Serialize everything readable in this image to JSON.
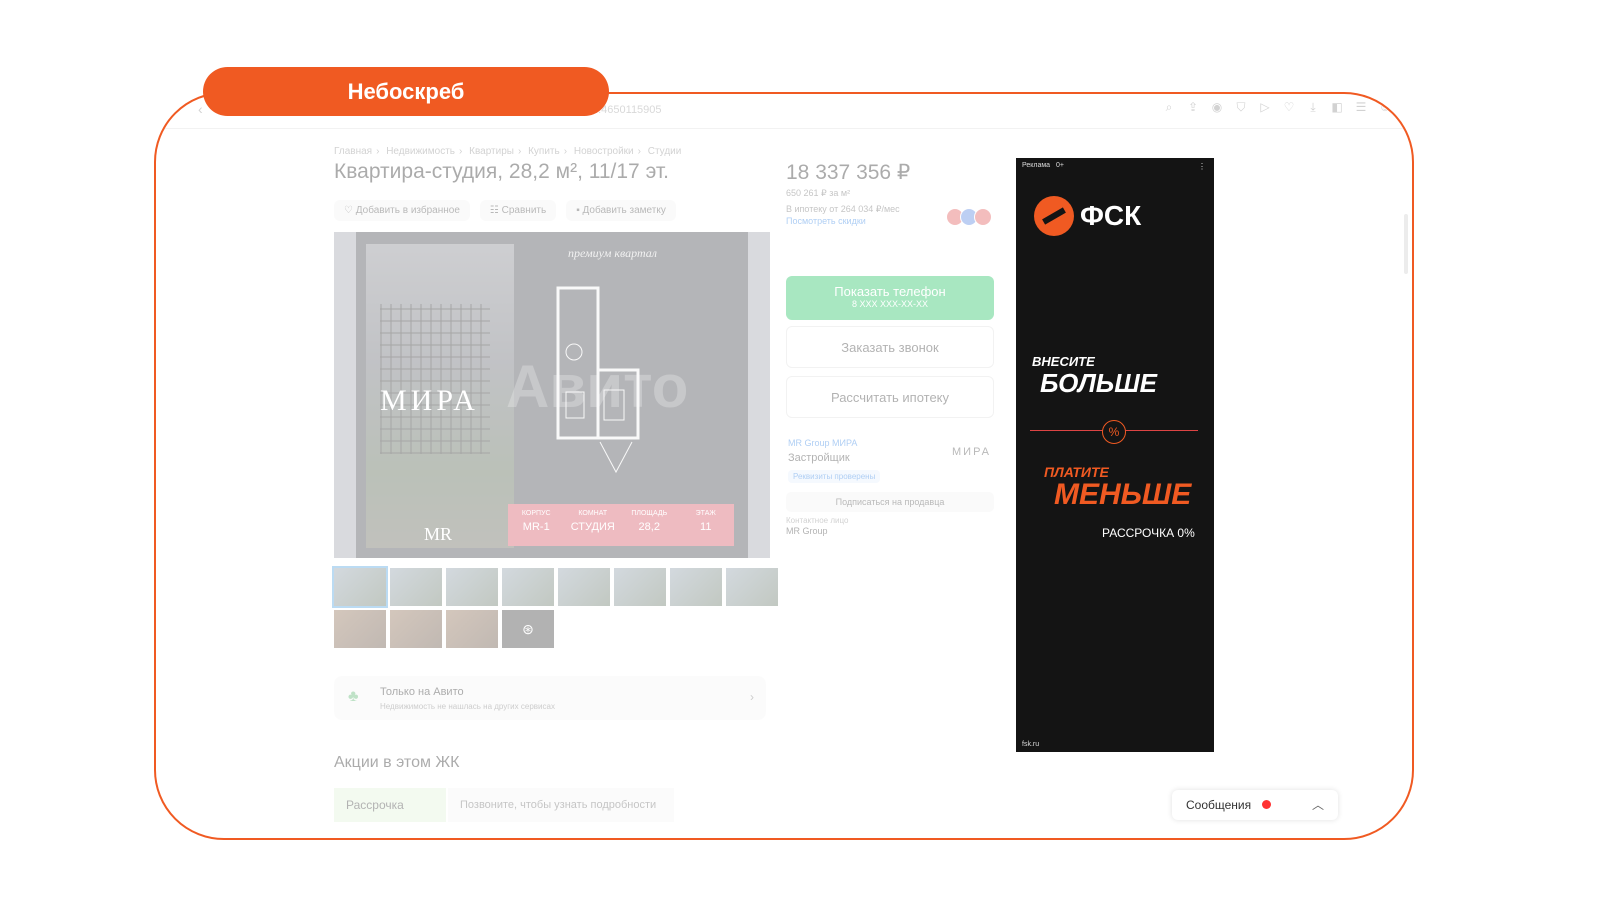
{
  "overlay_tag": "Небоскреб",
  "browser": {
    "url": "...4650115905",
    "toolbar_icons": [
      "search-icon",
      "share-icon",
      "camera-icon",
      "shield-icon",
      "play-icon",
      "heart-icon",
      "download-icon",
      "sidebar-icon",
      "menu-icon",
      "profile-icon"
    ]
  },
  "breadcrumbs": [
    "Главная",
    "Недвижимость",
    "Квартиры",
    "Купить",
    "Новостройки",
    "Студии"
  ],
  "listing": {
    "title": "Квартира-студия, 28,2 м², 11/17 эт.",
    "actions": {
      "favorite": "Добавить в избранное",
      "compare": "Сравнить",
      "note": "Добавить заметку"
    },
    "gallery": {
      "brand": "МИРА",
      "premium": "премиум квартал",
      "watermark": "Авито",
      "logo": "MR",
      "specs": [
        {
          "label": "КОРПУС",
          "value": "MR-1"
        },
        {
          "label": "КОМНАТ",
          "value": "СТУДИЯ"
        },
        {
          "label": "ПЛОЩАДЬ",
          "value": "28,2"
        },
        {
          "label": "ЭТАЖ",
          "value": "11"
        }
      ]
    },
    "only_avito": {
      "title": "Только на Авито",
      "subtitle": "Недвижимость не нашлась на других сервисах"
    },
    "promos": {
      "heading": "Акции в этом ЖК",
      "tab": "Рассрочка",
      "text": "Позвоните, чтобы узнать подробности"
    }
  },
  "sidebar": {
    "price": "18 337 356 ₽",
    "price_per_m2": "650 261 ₽ за м²",
    "mortgage": "В ипотеку от 264 034 ₽/мес",
    "discounts_link": "Посмотреть скидки",
    "phone_button": {
      "label": "Показать телефон",
      "sub": "8 XXX XXX-XX-XX"
    },
    "callback_button": "Заказать звонок",
    "mortgage_button": "Рассчитать ипотеку",
    "seller": {
      "name": "MR Group МИРА",
      "role": "Застройщик",
      "logo": "МИРА",
      "verified": "Реквизиты проверены"
    },
    "subscribe": "Подписаться на продавца",
    "contact_label": "Контактное лицо",
    "contact_name": "MR Group"
  },
  "ad": {
    "label": "Реклама",
    "age": "0+",
    "logo": "ФСК",
    "line1": "ВНЕСИТЕ",
    "line2": "БОЛЬШЕ",
    "percent": "%",
    "line3": "ПЛАТИТЕ",
    "line4": "МЕНЬШЕ",
    "line5": "РАССРОЧКА 0%",
    "footer": "fsk.ru"
  },
  "messages": {
    "label": "Сообщения"
  }
}
